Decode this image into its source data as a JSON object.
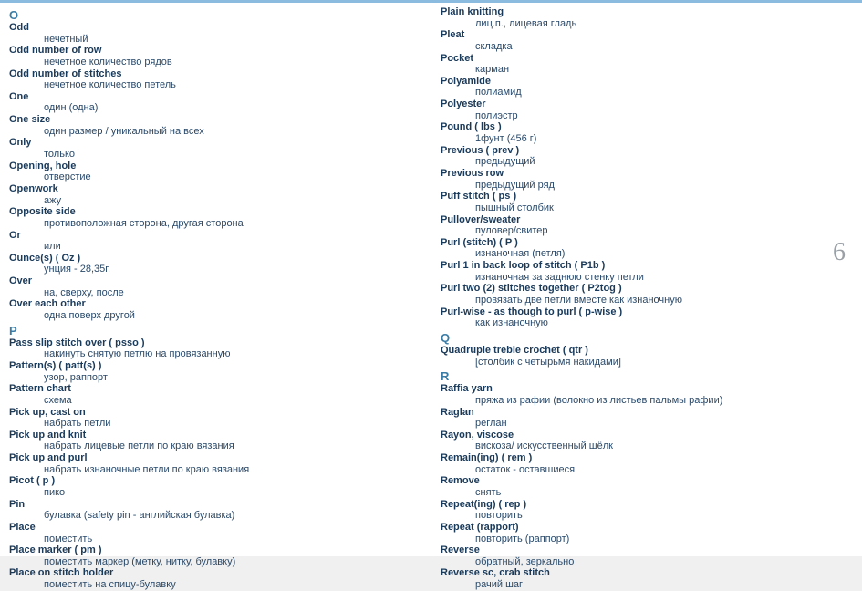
{
  "page_number": "6",
  "col_left": {
    "sections": [
      {
        "letter": "O",
        "entries": [
          {
            "term": "Odd",
            "def": "нечетный"
          },
          {
            "term": "Odd number of row",
            "def": "нечетное количество рядов"
          },
          {
            "term": "Odd number of stitches",
            "def": "нечетное количество петель"
          },
          {
            "term": "One",
            "def": "один (одна)"
          },
          {
            "term": "One size",
            "def": "один размер / уникальный на всех"
          },
          {
            "term": "Only",
            "def": "только"
          },
          {
            "term": "Opening, hole",
            "def": "отверстие"
          },
          {
            "term": "Openwork",
            "def": "ажу"
          },
          {
            "term": "Opposite side",
            "def": "противоположная сторона, другая сторона"
          },
          {
            "term": "Or",
            "def": "или"
          },
          {
            "term": "Ounce(s) ( Oz )",
            "def": "унция - 28,35г."
          },
          {
            "term": "Over",
            "def": "на, сверху, после"
          },
          {
            "term": "Over each other",
            "def": "одна поверх другой"
          }
        ]
      },
      {
        "letter": "P",
        "entries": [
          {
            "term": "Pass slip stitch over ( psso )",
            "def": "накинуть снятую петлю на провязанную"
          },
          {
            "term": "Pattern(s) ( patt(s) )",
            "def": "узор, раппорт"
          },
          {
            "term": "Pattern chart",
            "def": "схема"
          },
          {
            "term": "Pick up, cast on",
            "def": "набрать петли"
          },
          {
            "term": "Pick up and knit",
            "def": "набрать лицевые петли по краю вязания"
          },
          {
            "term": "Pick up and purl",
            "def": "набрать изнаночные петли по краю вязания"
          },
          {
            "term": "Picot ( p )",
            "def": "пико"
          },
          {
            "term": "Pin",
            "def": "булавка (safety pin - английская булавка)"
          },
          {
            "term": "Place",
            "def": "поместить"
          },
          {
            "term": "Place marker ( pm )",
            "def": "поместить маркер (метку, нитку, булавку)"
          },
          {
            "term": "Place on stitch holder",
            "def": "поместить на спицу-булавку"
          }
        ]
      }
    ]
  },
  "col_right": {
    "sections": [
      {
        "letter": "",
        "entries": [
          {
            "term": "Plain knitting",
            "def": "лиц.п., лицевая гладь"
          },
          {
            "term": "Pleat",
            "def": "складка"
          },
          {
            "term": "Pocket",
            "def": "карман"
          },
          {
            "term": "Polyamide",
            "def": "полиамид"
          },
          {
            "term": "Polyester",
            "def": "полиэстр"
          },
          {
            "term": "Pound ( lbs )",
            "def": "1фунт (456 г)"
          },
          {
            "term": "Previous ( prev )",
            "def": "предыдущий"
          },
          {
            "term": "Previous row",
            "def": "предыдущий ряд"
          },
          {
            "term": "Puff stitch ( ps )",
            "def": "пышный столбик"
          },
          {
            "term": "Pullover/sweater",
            "def": "пуловер/свитер"
          },
          {
            "term": "Purl (stitch) ( P )",
            "def": "изнаночная (петля)"
          },
          {
            "term": "Purl 1 in back loop of stitch ( P1b )",
            "def": "изнаночная за заднюю стенку петли"
          },
          {
            "term": "Purl two (2) stitches together ( P2tog )",
            "def": "провязать две петли вместе как изнаночную"
          },
          {
            "term": "Purl-wise - as though to purl ( p-wise )",
            "def": "как изнаночную"
          }
        ]
      },
      {
        "letter": "Q",
        "entries": [
          {
            "term": "Quadruple treble crochet ( qtr )",
            "def": "[столбик с четырьмя накидами]"
          }
        ]
      },
      {
        "letter": "R",
        "entries": [
          {
            "term": "Raffia yarn",
            "def": "пряжа из рафии (волокно из листьев пальмы рафии)"
          },
          {
            "term": "Raglan",
            "def": "реглан"
          },
          {
            "term": "Rayon, viscose",
            "def": "вискоза/ искусственный шёлк"
          },
          {
            "term": "Remain(ing) ( rem )",
            "def": "остаток - оставшиеся"
          },
          {
            "term": "Remove",
            "def": "снять"
          },
          {
            "term": "Repeat(ing) ( rep )",
            "def": "повторить"
          },
          {
            "term": "Repeat (rapport)",
            "def": "повторить (раппорт)"
          },
          {
            "term": "Reverse",
            "def": "обратный, зеркально"
          },
          {
            "term": "Reverse sc, crab stitch",
            "def": "рачий шаг"
          }
        ]
      }
    ]
  }
}
